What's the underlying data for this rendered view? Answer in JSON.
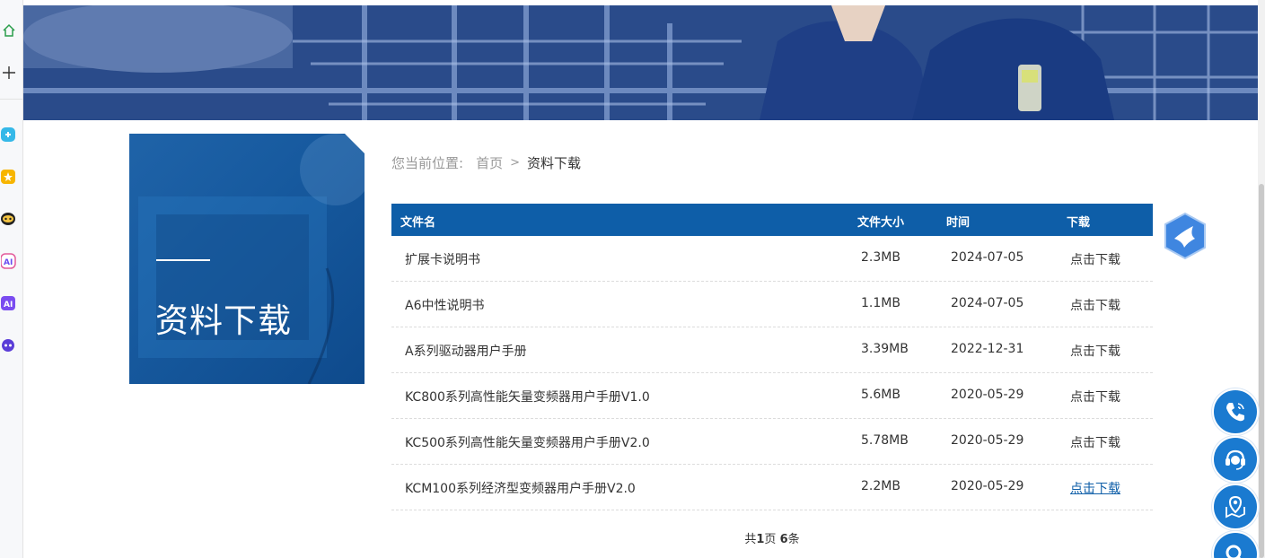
{
  "breadcrumb": {
    "prefix": "您当前位置:",
    "home": "首页",
    "separator": ">",
    "current": "资料下载"
  },
  "side_title": "资料下载",
  "table": {
    "headers": {
      "name": "文件名",
      "size": "文件大小",
      "time": "时间",
      "download": "下载"
    },
    "rows": [
      {
        "name": "扩展卡说明书",
        "size": "2.3MB",
        "time": "2024-07-05",
        "download": "点击下载"
      },
      {
        "name": "A6中性说明书",
        "size": "1.1MB",
        "time": "2024-07-05",
        "download": "点击下载"
      },
      {
        "name": "A系列驱动器用户手册",
        "size": "3.39MB",
        "time": "2022-12-31",
        "download": "点击下载"
      },
      {
        "name": "KC800系列高性能矢量变频器用户手册V1.0",
        "size": "5.6MB",
        "time": "2020-05-29",
        "download": "点击下载"
      },
      {
        "name": "KC500系列高性能矢量变频器用户手册V2.0",
        "size": "5.78MB",
        "time": "2020-05-29",
        "download": "点击下载"
      },
      {
        "name": "KCM100系列经济型变频器用户手册V2.0",
        "size": "2.2MB",
        "time": "2020-05-29",
        "download": "点击下载"
      }
    ]
  },
  "pager": {
    "pre": "共",
    "page": "1",
    "mid": "页 ",
    "count": "6",
    "post": "条"
  },
  "colors": {
    "accent": "#0e5ea8",
    "float_button": "#1a7ad0"
  },
  "icons": {
    "sidebar": [
      "home-icon",
      "plus-icon",
      "app-icon",
      "star-icon",
      "chat-icon",
      "ai-icon",
      "ai-icon",
      "bot-icon"
    ],
    "floating": [
      "phone-icon",
      "customer-service-icon",
      "location-icon",
      "search-icon"
    ],
    "bird": "bird-icon"
  }
}
